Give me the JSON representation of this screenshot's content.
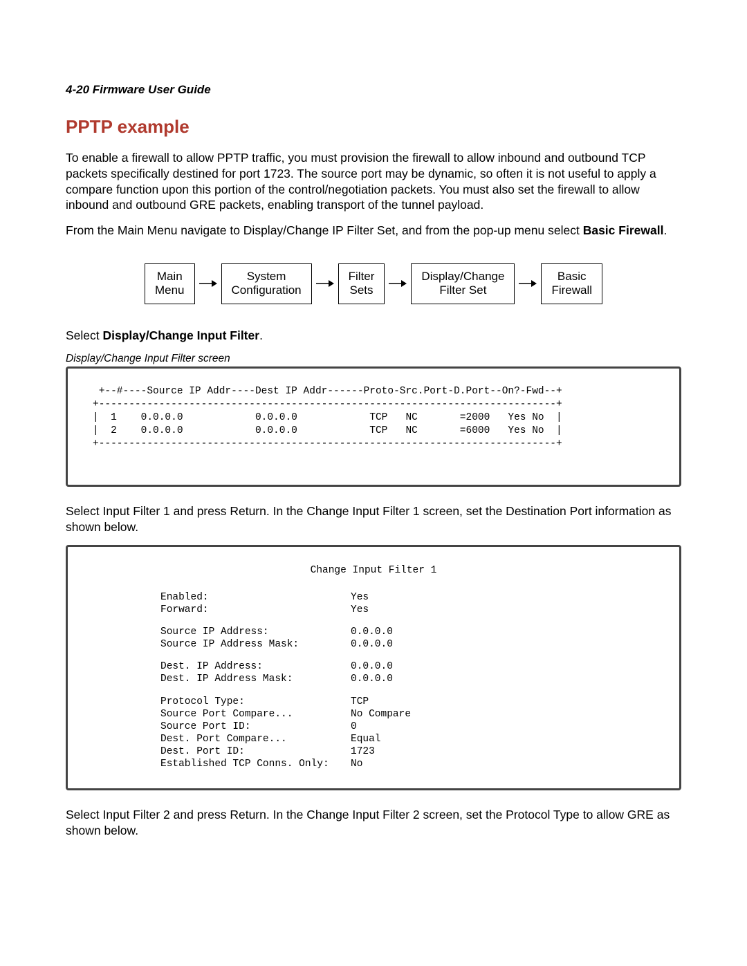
{
  "header": "4-20  Firmware User Guide",
  "title": "PPTP example",
  "para1": "To enable a firewall to allow PPTP traffic, you must provision the firewall to allow inbound and outbound TCP packets specifically destined for port 1723. The source port may be dynamic, so often it is not useful to apply a compare function upon this portion of the control/negotiation packets. You must also set the firewall to allow inbound and outbound GRE packets, enabling transport of the tunnel payload.",
  "para2_pre": "From the Main Menu navigate to Display/Change IP Filter Set, and from the pop-up menu select ",
  "para2_bold": "Basic Firewall",
  "para2_post": ".",
  "nav": {
    "b1a": "Main",
    "b1b": "Menu",
    "b2a": "System",
    "b2b": "Configuration",
    "b3a": "Filter",
    "b3b": "Sets",
    "b4a": "Display/Change",
    "b4b": "Filter Set",
    "b5a": "Basic",
    "b5b": "Firewall"
  },
  "select_line_pre": "Select ",
  "select_line_bold": "Display/Change Input Filter",
  "select_line_post": ".",
  "caption1": "Display/Change Input Filter screen",
  "table_screen": " +--#----Source IP Addr----Dest IP Addr------Proto-Src.Port-D.Port--On?-Fwd--+\n+----------------------------------------------------------------------------+\n|  1    0.0.0.0            0.0.0.0            TCP   NC       =2000   Yes No  |\n|  2    0.0.0.0            0.0.0.0            TCP   NC       =6000   Yes No  |\n+----------------------------------------------------------------------------+",
  "para3": "Select Input Filter 1 and press Return. In the Change Input Filter 1 screen, set the Destination Port information as shown below.",
  "form": {
    "title": "Change Input Filter 1",
    "rows": [
      [
        {
          "label": "Enabled:",
          "value": "Yes"
        },
        {
          "label": "Forward:",
          "value": "Yes"
        }
      ],
      [
        {
          "label": "Source IP Address:",
          "value": "0.0.0.0"
        },
        {
          "label": "Source IP Address Mask:",
          "value": "0.0.0.0"
        }
      ],
      [
        {
          "label": "Dest. IP Address:",
          "value": "0.0.0.0"
        },
        {
          "label": "Dest. IP Address Mask:",
          "value": "0.0.0.0"
        }
      ],
      [
        {
          "label": "Protocol Type:",
          "value": "TCP"
        },
        {
          "label": "Source Port Compare...",
          "value": "No Compare"
        },
        {
          "label": "Source Port ID:",
          "value": "0"
        },
        {
          "label": "Dest. Port Compare...",
          "value": "Equal"
        },
        {
          "label": "Dest. Port ID:",
          "value": "1723"
        },
        {
          "label": "Established TCP Conns. Only:",
          "value": "No"
        }
      ]
    ]
  },
  "para4": "Select Input Filter 2 and press Return. In the Change Input Filter 2 screen, set the Protocol Type to allow GRE as shown below."
}
